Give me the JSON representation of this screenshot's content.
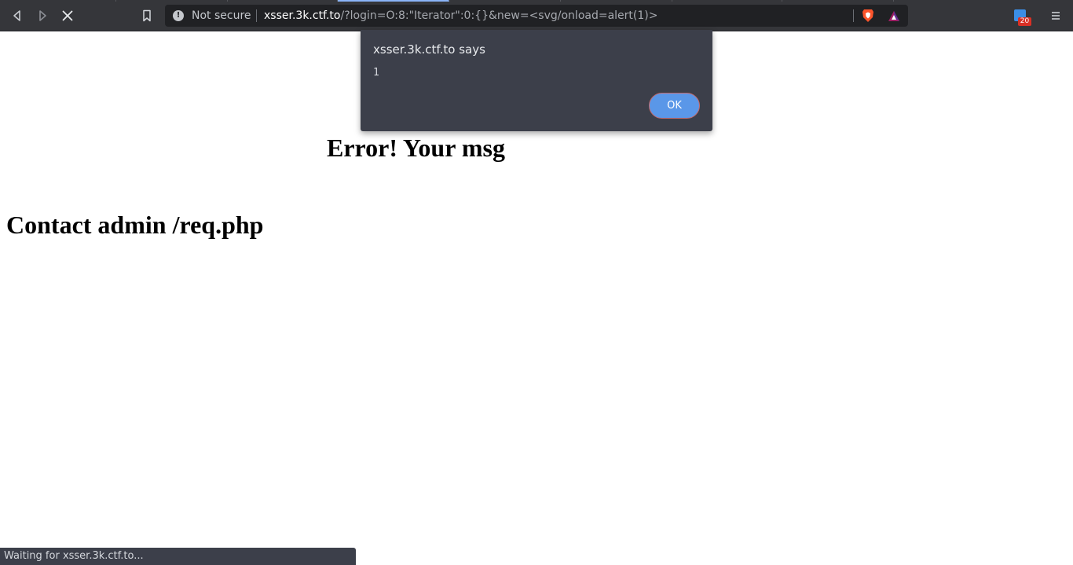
{
  "browser": {
    "security_label": "Not secure",
    "security_icon": "info-icon",
    "url_host": "xsser.3k.ctf.to",
    "url_rest": "/?login=O:8:\"Iterator\":0:{}&new=<svg/onload=alert(1)>",
    "extension_badge": "20",
    "status_text": "Waiting for xsser.3k.ctf.to...",
    "icons": {
      "back": "back-icon",
      "forward": "forward-icon",
      "stop": "stop-icon",
      "bookmark": "bookmark-icon",
      "shields": "brave-shield-icon",
      "rewards": "brave-rewards-icon",
      "extension": "extension-icon",
      "menu": "menu-icon"
    },
    "colors": {
      "toolbar": "#35363a",
      "urlbar": "#202124",
      "dialog": "#3c3f4a",
      "ok_button": "#5a97e8",
      "badge": "#d93025"
    }
  },
  "dialog": {
    "title": "xsser.3k.ctf.to says",
    "message": "1",
    "ok_label": "OK"
  },
  "page": {
    "error_heading": "Error! Your msg",
    "contact_heading": "Contact admin /req.php"
  }
}
